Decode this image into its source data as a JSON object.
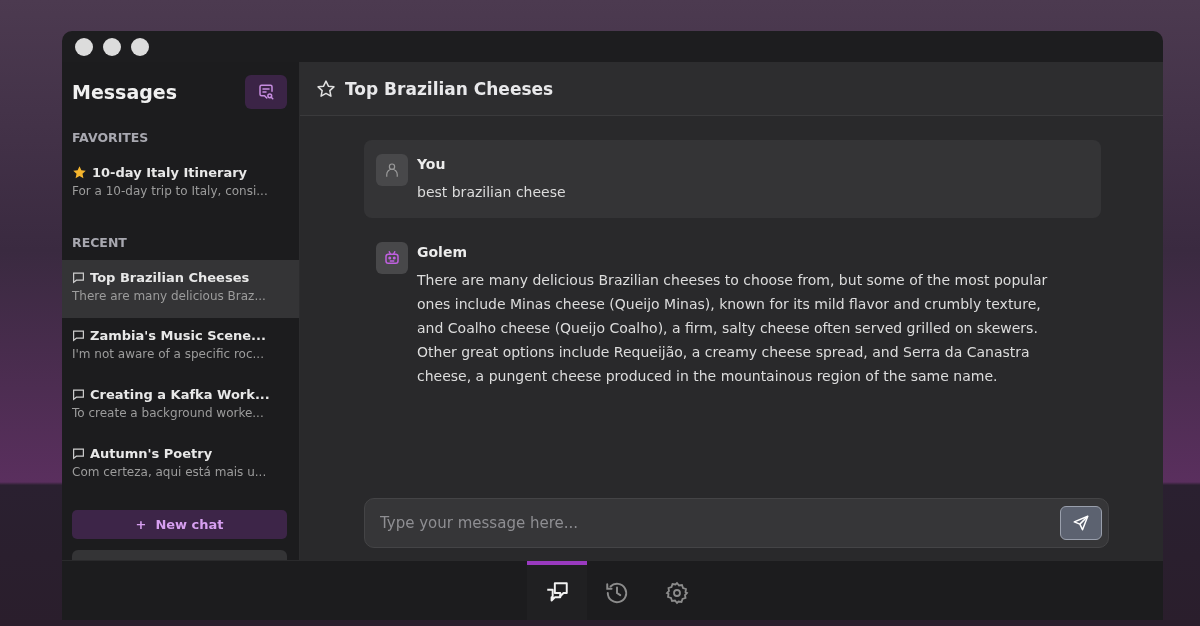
{
  "sidebar": {
    "title": "Messages",
    "sections": [
      {
        "label": "FAVORITES",
        "chats": [
          {
            "kind": "favorite",
            "title": "10-day Italy Itinerary",
            "preview": "For a 10-day trip to Italy, consi...",
            "selected": false
          }
        ]
      },
      {
        "label": "RECENT",
        "chats": [
          {
            "kind": "recent",
            "title": "Top Brazilian Cheeses",
            "preview": "There are many delicious Braz...",
            "selected": true
          },
          {
            "kind": "recent",
            "title": "Zambia's Music Scene...",
            "preview": "I'm not aware of a specific roc...",
            "selected": false
          },
          {
            "kind": "recent",
            "title": "Creating a Kafka Work...",
            "preview": "To create a background worke...",
            "selected": false
          },
          {
            "kind": "recent",
            "title": "Autumn's Poetry",
            "preview": "Com certeza, aqui está mais u...",
            "selected": false
          }
        ]
      }
    ],
    "new_chat": {
      "icon": "+",
      "label": "New chat"
    }
  },
  "chat": {
    "title": "Top Brazilian Cheeses",
    "messages": [
      {
        "kind": "user",
        "author": "You",
        "text": "best brazilian cheese"
      },
      {
        "kind": "bot",
        "author": "Golem",
        "text": "There are many delicious Brazilian cheeses to choose from, but some of the most popular ones include Minas cheese (Queijo Minas), known for its mild flavor and crumbly texture, and Coalho cheese (Queijo Coalho), a firm, salty cheese often served grilled on skewers. Other great options include Requeijão, a creamy cheese spread, and Serra da Canastra cheese, a pungent cheese produced in the mountainous region of the same name."
      }
    ],
    "input": {
      "placeholder": "Type your message here..."
    }
  },
  "nav_tabs": [
    {
      "kind": "chats",
      "selected": true
    },
    {
      "kind": "history",
      "selected": false
    },
    {
      "kind": "settings",
      "selected": false
    }
  ]
}
